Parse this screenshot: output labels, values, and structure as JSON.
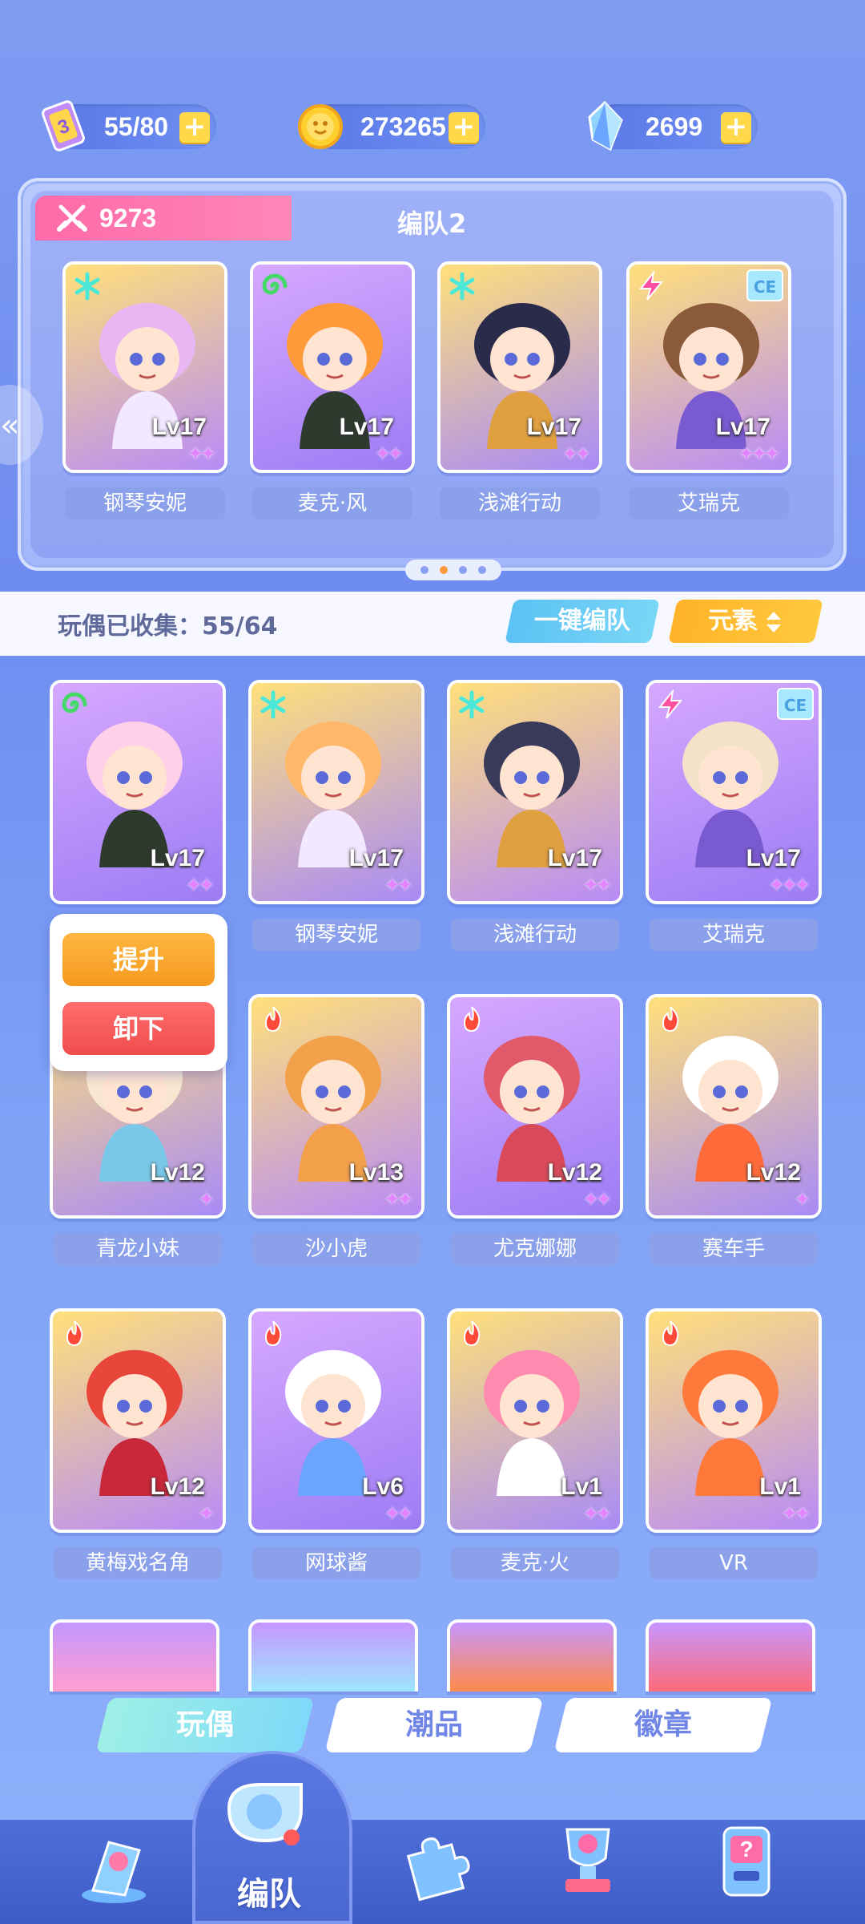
{
  "resources": {
    "energy": "55/80",
    "coins": "273265",
    "gems": "2699",
    "plus": "+"
  },
  "team_panel": {
    "power": "9273",
    "title": "编队2",
    "page_count": 4,
    "active_page": 2,
    "members": [
      {
        "name": "钢琴安妮",
        "level": "Lv17",
        "element": "ice",
        "stars": "✦✦"
      },
      {
        "name": "麦克·风",
        "level": "Lv17",
        "element": "wind",
        "stars": "✦✦"
      },
      {
        "name": "浅滩行动",
        "level": "Lv17",
        "element": "ice",
        "stars": "✦✦"
      },
      {
        "name": "艾瑞克",
        "level": "Lv17",
        "element": "thunder",
        "stars": "✦✦✦",
        "badge": "CE"
      }
    ]
  },
  "collection": {
    "label": "玩偶已收集：55/64",
    "one_click_team": "一键编队",
    "element_filter": "元素"
  },
  "popup": {
    "upgrade": "提升",
    "remove": "卸下"
  },
  "grid": [
    {
      "name": "",
      "level": "Lv17",
      "element": "wind",
      "stars": "✦✦"
    },
    {
      "name": "钢琴安妮",
      "level": "Lv17",
      "element": "ice",
      "stars": "✦✦"
    },
    {
      "name": "浅滩行动",
      "level": "Lv17",
      "element": "ice",
      "stars": "✦✦"
    },
    {
      "name": "艾瑞克",
      "level": "Lv17",
      "element": "thunder",
      "stars": "✦✦✦",
      "badge": "CE"
    },
    {
      "name": "青龙小妹",
      "level": "Lv12",
      "element": "fire",
      "stars": "✦"
    },
    {
      "name": "沙小虎",
      "level": "Lv13",
      "element": "fire",
      "stars": "✦✦"
    },
    {
      "name": "尤克娜娜",
      "level": "Lv12",
      "element": "fire",
      "stars": "✦✦"
    },
    {
      "name": "赛车手",
      "level": "Lv12",
      "element": "fire",
      "stars": "✦"
    },
    {
      "name": "黄梅戏名角",
      "level": "Lv12",
      "element": "fire",
      "stars": "✦"
    },
    {
      "name": "网球酱",
      "level": "Lv6",
      "element": "fire",
      "stars": "✦✦"
    },
    {
      "name": "麦克·火",
      "level": "Lv1",
      "element": "fire",
      "stars": "✦✦"
    },
    {
      "name": "VR",
      "level": "Lv1",
      "element": "fire",
      "stars": "✦✦"
    }
  ],
  "tabs": {
    "dolls": "玩偶",
    "trendy": "潮品",
    "badges": "徽章"
  },
  "nav": {
    "team_label": "编队"
  },
  "colors": {
    "accent_pink": "#ff6aa8",
    "accent_orange": "#ffb32a",
    "accent_cyan": "#5bc2f4",
    "card_purple": "#b68bf5"
  }
}
